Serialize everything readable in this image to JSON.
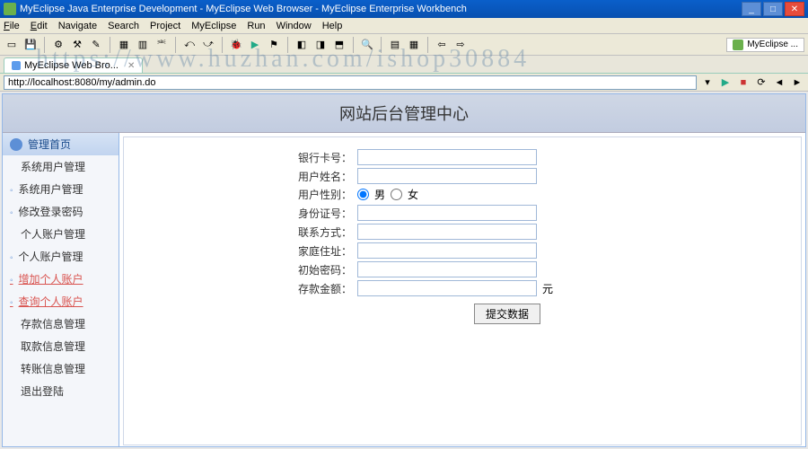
{
  "titlebar": {
    "title": "MyEclipse Java Enterprise Development - MyEclipse Web Browser - MyEclipse Enterprise Workbench"
  },
  "menu": {
    "items": [
      "File",
      "Edit",
      "Navigate",
      "Search",
      "Project",
      "MyEclipse",
      "Run",
      "Window",
      "Help"
    ]
  },
  "toolbar": {
    "badge": "MyEclipse ..."
  },
  "tab": {
    "label": "MyEclipse Web Bro..."
  },
  "watermark": "https://www.huzhan.com/ishop30884",
  "address": {
    "value": "http://localhost:8080/my/admin.do"
  },
  "page": {
    "header": "网站后台管理中心"
  },
  "sidebar": {
    "head": "管理首页",
    "items": [
      {
        "label": "系统用户管理",
        "bullet": false
      },
      {
        "label": "系统用户管理",
        "bullet": true
      },
      {
        "label": "修改登录密码",
        "bullet": true
      },
      {
        "label": "个人账户管理",
        "bullet": false
      },
      {
        "label": "个人账户管理",
        "bullet": true
      },
      {
        "label": "增加个人账户",
        "bullet": true,
        "active": true
      },
      {
        "label": "查询个人账户",
        "bullet": true,
        "active": true
      },
      {
        "label": "存款信息管理",
        "bullet": false
      },
      {
        "label": "取款信息管理",
        "bullet": false
      },
      {
        "label": "转账信息管理",
        "bullet": false
      },
      {
        "label": "退出登陆",
        "bullet": false
      }
    ]
  },
  "form": {
    "fields": [
      {
        "label": "银行卡号：",
        "type": "text"
      },
      {
        "label": "用户姓名：",
        "type": "text"
      },
      {
        "label": "用户性别：",
        "type": "radio"
      },
      {
        "label": "身份证号：",
        "type": "text"
      },
      {
        "label": "联系方式：",
        "type": "text"
      },
      {
        "label": "家庭住址：",
        "type": "text"
      },
      {
        "label": "初始密码：",
        "type": "text"
      },
      {
        "label": "存款金额：",
        "type": "text",
        "suffix": "元"
      }
    ],
    "gender": {
      "opt1": "男",
      "opt2": "女"
    },
    "submit": "提交数据"
  }
}
